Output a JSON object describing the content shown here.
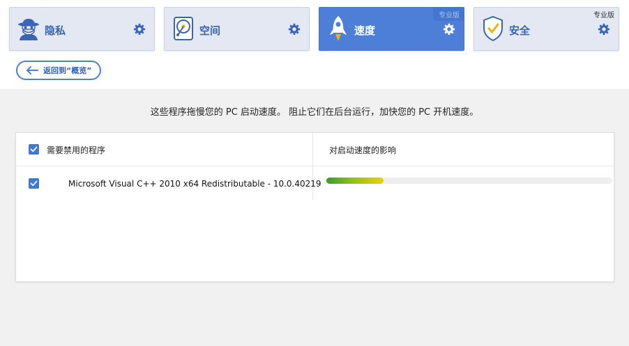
{
  "tabs": [
    {
      "label": "隐私",
      "icon": "spy-icon",
      "active": false,
      "badge": ""
    },
    {
      "label": "空间",
      "icon": "disk-icon",
      "active": false,
      "badge": ""
    },
    {
      "label": "速度",
      "icon": "rocket-icon",
      "active": true,
      "badge": "专业版"
    },
    {
      "label": "安全",
      "icon": "shield-icon",
      "active": false,
      "badge": "专业版"
    }
  ],
  "back_button": {
    "label": "返回到“概览”"
  },
  "description": "这些程序拖慢您的 PC 启动速度。 阻止它们在后台运行，加快您的 PC 开机速度。",
  "table": {
    "col1_header": "需要禁用的程序",
    "col2_header": "对启动速度的影响",
    "rows": [
      {
        "name": "Microsoft Visual C++ 2010 x64 Redistributable - 10.0.40219",
        "checked": true,
        "impact": 0.2
      }
    ]
  },
  "colors": {
    "accent": "#4d7fd8",
    "checkbox": "#3e78d8"
  }
}
